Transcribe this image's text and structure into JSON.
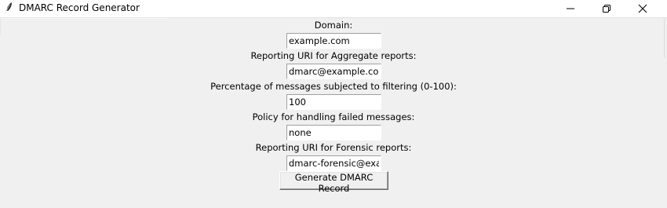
{
  "window": {
    "title": "DMARC Record Generator",
    "icon": "feather-icon"
  },
  "controls": {
    "minimize_icon": "minimize-icon",
    "restore_icon": "restore-icon",
    "close_icon": "close-icon"
  },
  "form": {
    "domain_label": "Domain:",
    "domain_value": "example.com",
    "rua_label": "Reporting URI for Aggregate reports:",
    "rua_value": "dmarc@example.com",
    "pct_label": "Percentage of messages subjected to filtering (0-100):",
    "pct_value": "100",
    "policy_label": "Policy for handling failed messages:",
    "policy_value": "none",
    "ruf_label": "Reporting URI for Forensic reports:",
    "ruf_value": "dmarc-forensic@example.com",
    "generate_label": "Generate DMARC Record"
  },
  "colors": {
    "background": "#f0f0f0",
    "titlebar": "#ffffff",
    "entry_background": "#ffffff"
  }
}
